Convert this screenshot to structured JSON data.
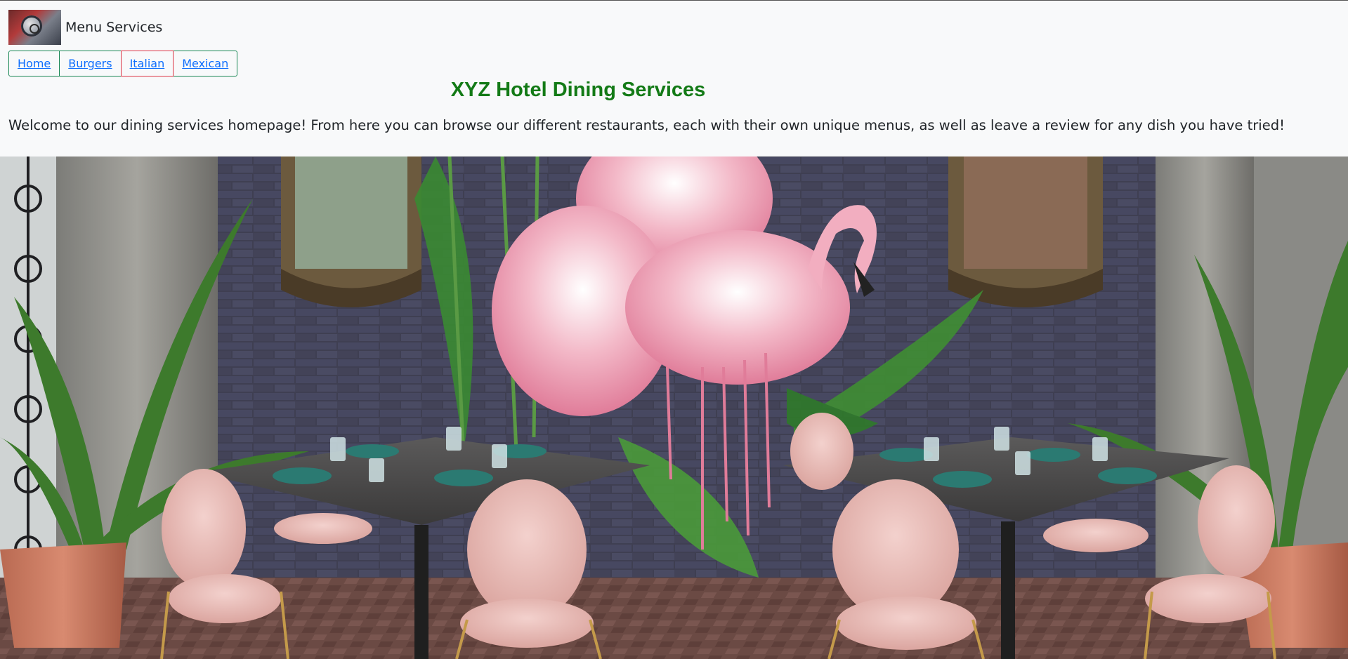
{
  "header": {
    "brand_text": "Menu Services",
    "logo": "restaurant-logo"
  },
  "nav": {
    "items": [
      {
        "label": "Home"
      },
      {
        "label": "Burgers"
      },
      {
        "label": "Italian"
      },
      {
        "label": "Mexican"
      }
    ]
  },
  "main": {
    "title": "XYZ Hotel Dining Services",
    "intro": "Welcome to our dining services homepage! From here you can browse our different restaurants, each with their own unique menus, as well as leave a review for any dish you have tried!"
  },
  "hero": {
    "image": "restaurant-interior-photo"
  },
  "colors": {
    "title": "#137a16",
    "link": "#0d6efd",
    "nav_border": "#198754",
    "nav_active_border": "#dc3545",
    "background": "#f8f9fa"
  }
}
